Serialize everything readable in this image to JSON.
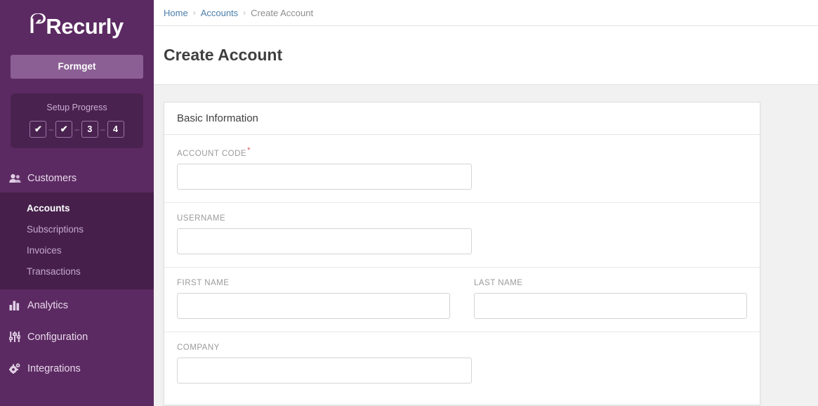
{
  "sidebar": {
    "brand": "Recurly",
    "brand_icon": "recurly-logo-icon",
    "account_button": "Formget",
    "progress": {
      "title": "Setup Progress",
      "steps": [
        {
          "label": "✔",
          "state": "done"
        },
        {
          "label": "✔",
          "state": "done"
        },
        {
          "label": "3",
          "state": "pending"
        },
        {
          "label": "4",
          "state": "pending"
        }
      ],
      "separator": "–"
    },
    "groups": [
      {
        "label": "Customers",
        "icon": "users-icon",
        "expanded": true,
        "items": [
          {
            "label": "Accounts",
            "active": true
          },
          {
            "label": "Subscriptions",
            "active": false
          },
          {
            "label": "Invoices",
            "active": false
          },
          {
            "label": "Transactions",
            "active": false
          }
        ]
      }
    ],
    "items": [
      {
        "label": "Analytics",
        "icon": "bar-chart-icon"
      },
      {
        "label": "Configuration",
        "icon": "sliders-icon"
      },
      {
        "label": "Integrations",
        "icon": "gears-icon"
      }
    ]
  },
  "breadcrumb": {
    "separator": "›",
    "items": [
      {
        "label": "Home",
        "current": false
      },
      {
        "label": "Accounts",
        "current": false
      },
      {
        "label": "Create Account",
        "current": true
      }
    ]
  },
  "page": {
    "title": "Create Account"
  },
  "form": {
    "card_title": "Basic Information",
    "required_marker": "*",
    "rows": [
      {
        "fields": [
          {
            "label": "ACCOUNT CODE",
            "required": true,
            "value": "",
            "placeholder": "",
            "name": "account-code"
          }
        ]
      },
      {
        "fields": [
          {
            "label": "USERNAME",
            "required": false,
            "value": "",
            "placeholder": "",
            "name": "username"
          }
        ]
      },
      {
        "fields": [
          {
            "label": "FIRST NAME",
            "required": false,
            "value": "",
            "placeholder": "",
            "name": "first-name"
          },
          {
            "label": "LAST NAME",
            "required": false,
            "value": "",
            "placeholder": "",
            "name": "last-name"
          }
        ]
      },
      {
        "fields": [
          {
            "label": "COMPANY",
            "required": false,
            "value": "",
            "placeholder": "",
            "name": "company"
          }
        ]
      }
    ]
  },
  "colors": {
    "sidebar": "#5c2a62",
    "sidebar_dark": "#46204b",
    "panel": "#4a2250",
    "accent_button": "#8b5f94",
    "link": "#4a7eab",
    "required": "#d9534f",
    "body_bg": "#f1f1f1"
  }
}
